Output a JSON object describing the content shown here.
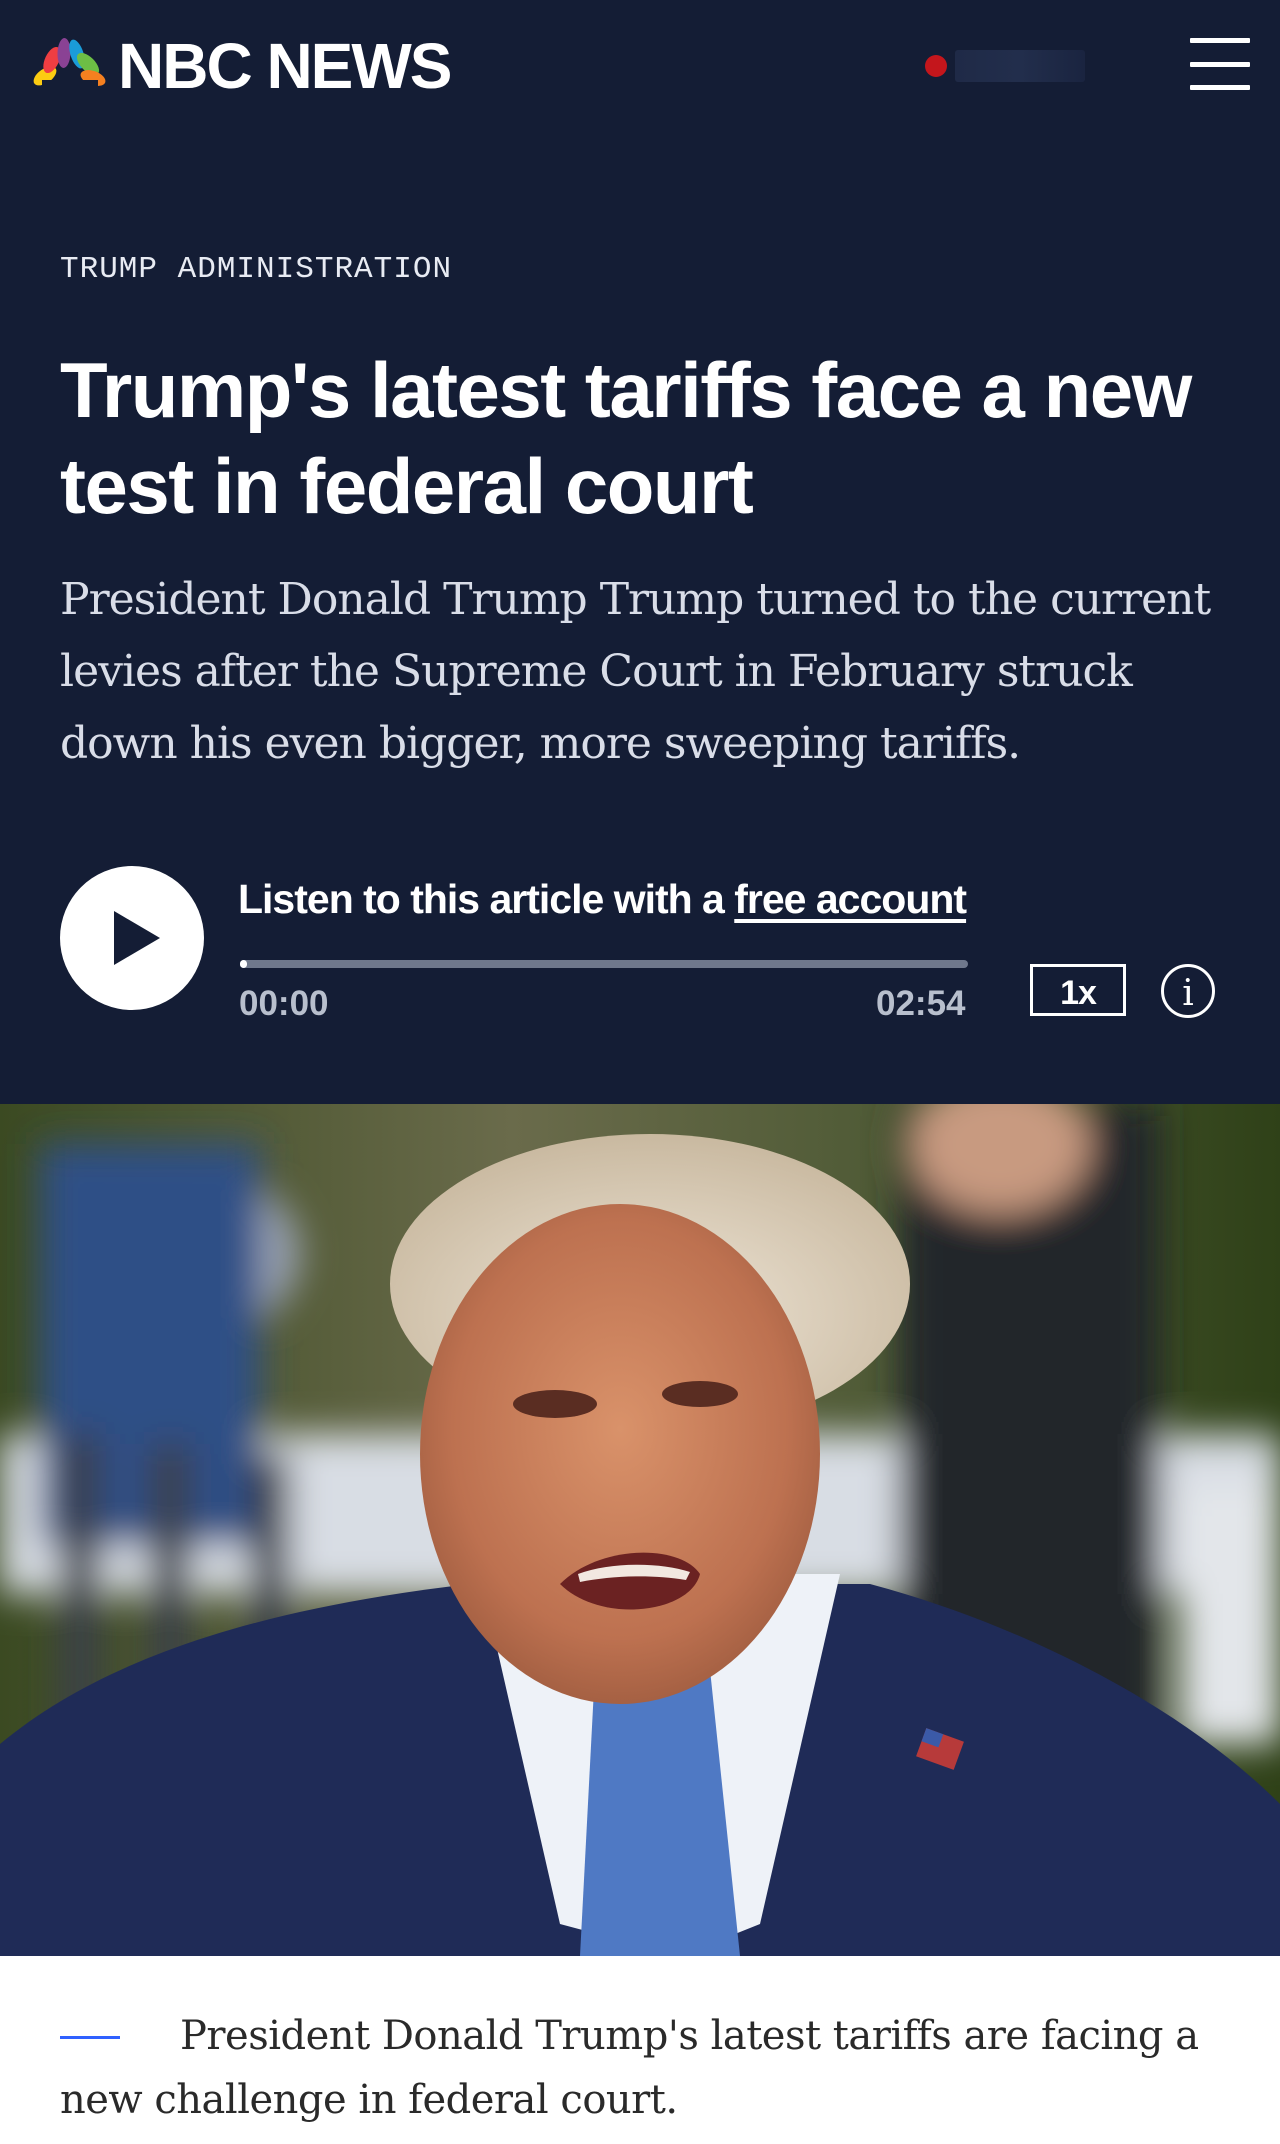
{
  "site": {
    "logo_text": "NBC NEWS",
    "logo_icon": "peacock-icon",
    "live_indicator_color": "#c4161c",
    "menu_icon": "hamburger-menu-icon",
    "header_background": "#141d35"
  },
  "article": {
    "section": "TRUMP ADMINISTRATION",
    "headline": "Trump's latest tariffs face a new test in federal court",
    "dek": "President Donald Trump Trump turned to the current levies after the Supreme Court in February struck down his even bigger, more sweeping tariffs."
  },
  "audio": {
    "listen_prefix": "Listen to this article with a ",
    "listen_link": "free account",
    "current_time": "00:00",
    "duration": "02:54",
    "progress_fraction": 0.0,
    "speed": "1x",
    "info_label": "i"
  },
  "photo": {
    "caption": "President Donald Trump's latest tariffs are facing a new challenge in federal court.",
    "caption_accent_color": "#3061ff"
  }
}
